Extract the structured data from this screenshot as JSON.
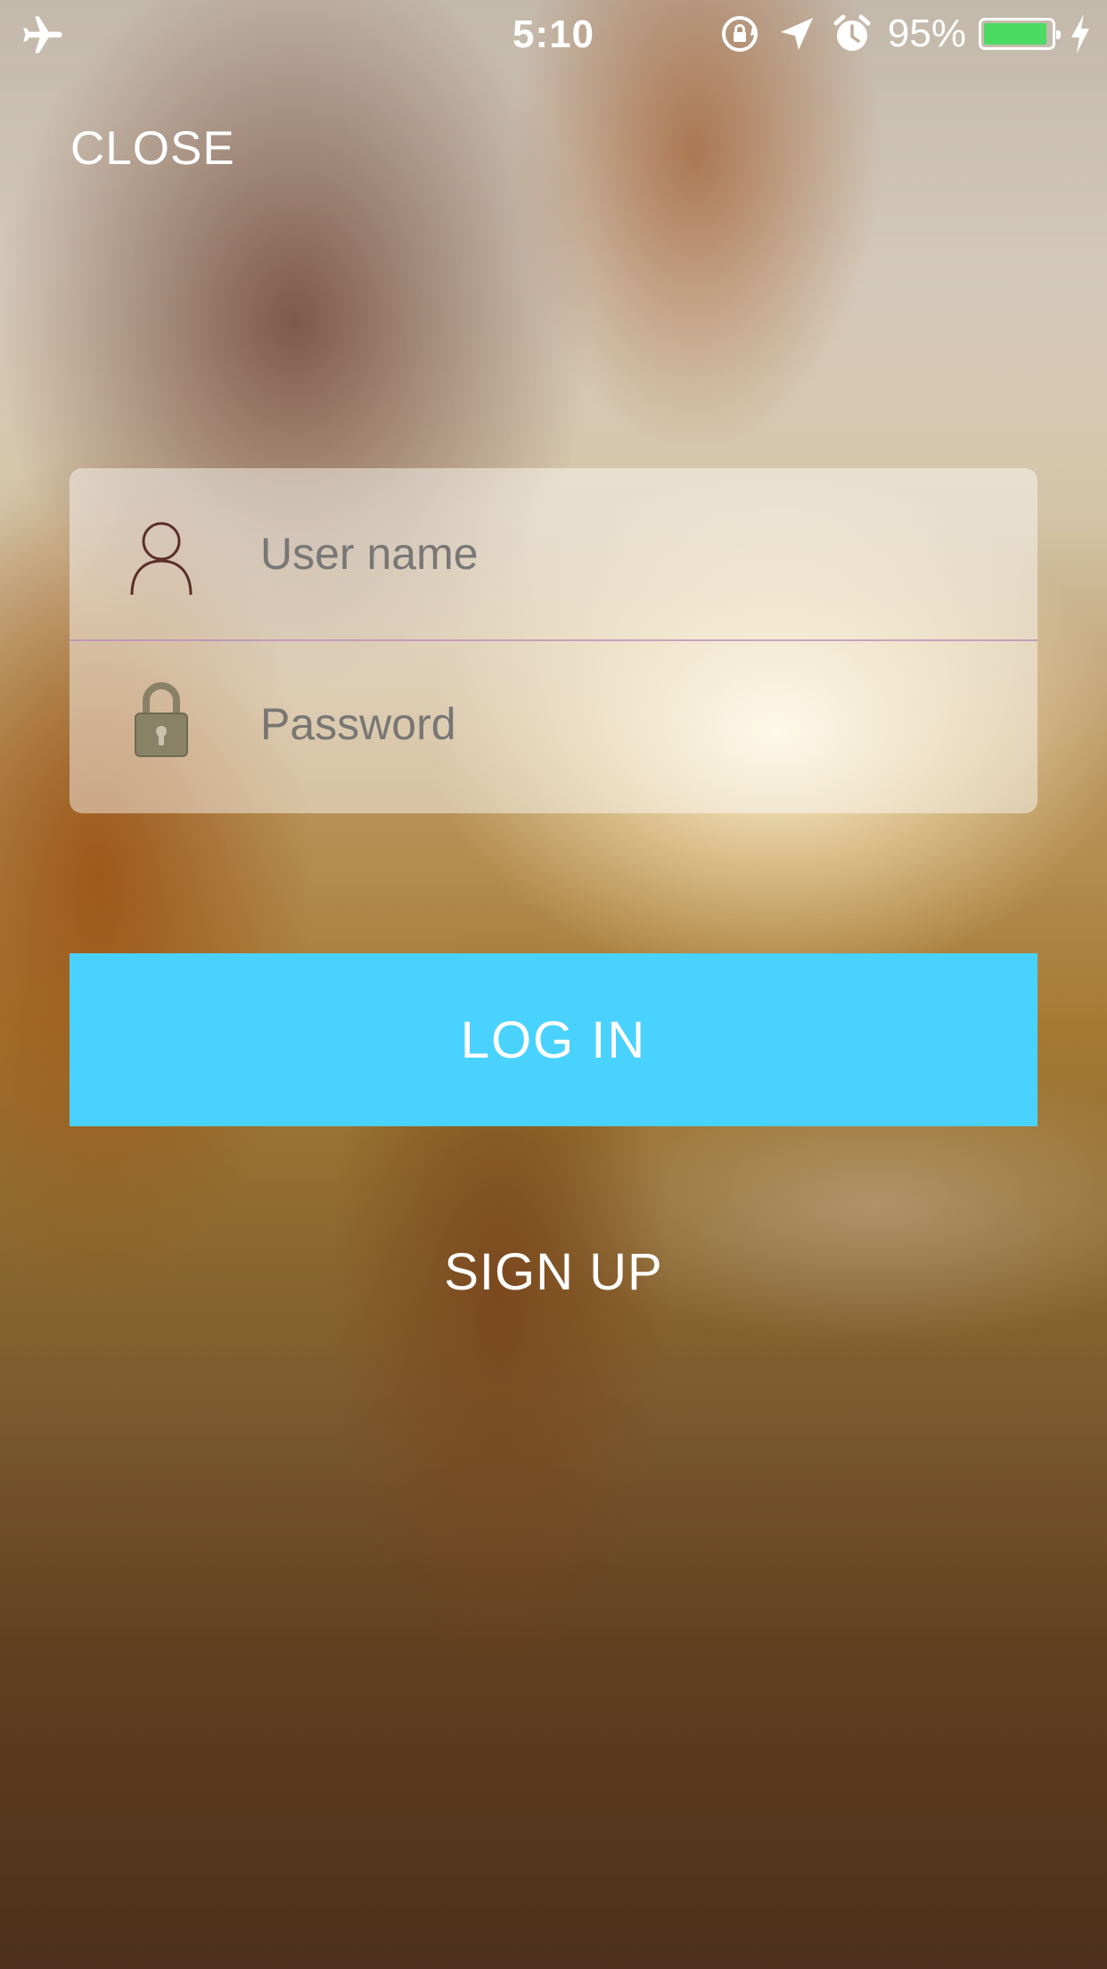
{
  "status_bar": {
    "time": "5:10",
    "battery_percent_text": "95%",
    "battery_level": 0.95,
    "battery_color": "#4cd964",
    "icons": [
      "airplane-mode-icon",
      "orientation-lock-icon",
      "location-arrow-icon",
      "alarm-icon",
      "battery-icon",
      "charging-bolt-icon"
    ]
  },
  "header": {
    "close_label": "CLOSE"
  },
  "form": {
    "username_placeholder": "User name",
    "password_placeholder": "Password",
    "username_icon": "user-icon",
    "password_icon": "lock-icon"
  },
  "actions": {
    "login_label": "LOG IN",
    "login_color": "#4ad2fe",
    "signup_label": "SIGN UP"
  }
}
